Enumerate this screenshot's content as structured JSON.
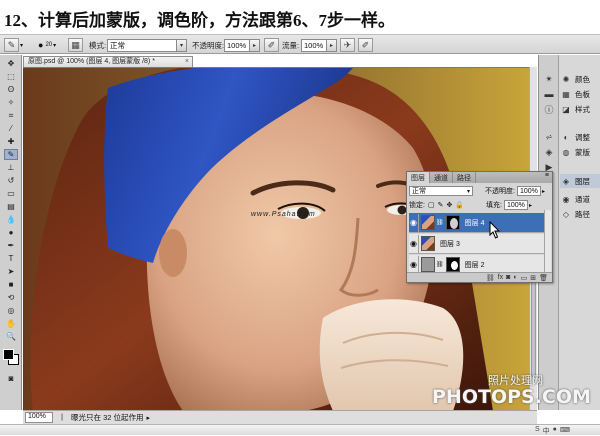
{
  "heading": "12、计算后加蒙版，调色阶，方法跟第6、7步一样。",
  "options_bar": {
    "brush_size": "20",
    "mode_label": "模式:",
    "mode_value": "正常",
    "opacity_label": "不透明度:",
    "opacity_value": "100%",
    "flow_label": "流量:",
    "flow_value": "100%"
  },
  "document": {
    "tab_title": "原图.psd @ 100% (图层 4, 图层蒙版 /8) *",
    "canvas_watermark": "www.Psaha.com"
  },
  "status": {
    "zoom": "100%",
    "info": "曝光只在 32 位起作用"
  },
  "dock": {
    "items": [
      {
        "label": "颜色",
        "icon": "color-wheel-icon"
      },
      {
        "label": "色板",
        "icon": "swatches-icon"
      },
      {
        "label": "样式",
        "icon": "styles-icon"
      },
      {
        "label": "调整",
        "icon": "adjustments-icon"
      },
      {
        "label": "蒙版",
        "icon": "masks-icon"
      },
      {
        "label": "图层",
        "icon": "layers-icon"
      },
      {
        "label": "通道",
        "icon": "channels-icon"
      },
      {
        "label": "路径",
        "icon": "paths-icon"
      }
    ]
  },
  "layers_panel": {
    "tabs": [
      "图层",
      "通道",
      "路径"
    ],
    "blend_mode": "正常",
    "opacity_label": "不透明度:",
    "opacity_value": "100%",
    "lock_label": "锁定:",
    "fill_label": "填充:",
    "fill_value": "100%",
    "layers": [
      {
        "name": "图层 4",
        "selected": true
      },
      {
        "name": "图层 3",
        "selected": false
      },
      {
        "name": "图层 2",
        "selected": false
      }
    ]
  },
  "watermark": {
    "cn": "照片处理网",
    "en": "PHOTOPS.COM"
  },
  "colors": {
    "headband": "#2a4fb8",
    "background_wall": "#b08f32",
    "selection": "#3d6fb6"
  }
}
